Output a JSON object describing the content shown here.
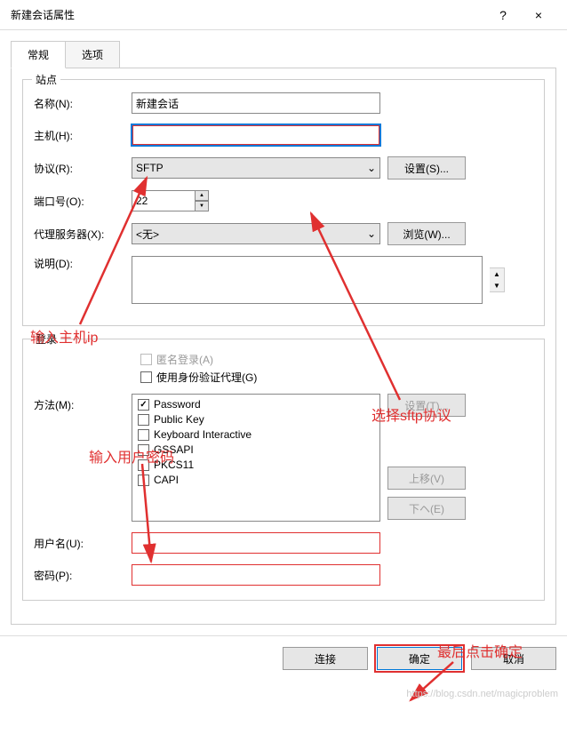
{
  "window": {
    "title": "新建会话属性",
    "help": "?",
    "close": "×"
  },
  "tabs": {
    "general": "常规",
    "options": "选项"
  },
  "site": {
    "legend": "站点",
    "name_label": "名称(N):",
    "name_value": "新建会话",
    "host_label": "主机(H):",
    "host_value": "",
    "protocol_label": "协议(R):",
    "protocol_value": "SFTP",
    "setup_btn": "设置(S)...",
    "port_label": "端口号(O):",
    "port_value": "22",
    "proxy_label": "代理服务器(X):",
    "proxy_value": "<无>",
    "browse_btn": "浏览(W)...",
    "desc_label": "说明(D):",
    "desc_value": ""
  },
  "login": {
    "legend": "登录",
    "anon_label": "匿名登录(A)",
    "auth_agent_label": "使用身份验证代理(G)",
    "method_label": "方法(M):",
    "methods": {
      "password": "Password",
      "publickey": "Public Key",
      "keyboard": "Keyboard Interactive",
      "gssapi": "GSSAPI",
      "pkcs11": "PKCS11",
      "capi": "CAPI"
    },
    "setup_btn": "设置(T)...",
    "moveup_btn": "上移(V)",
    "movedown_btn": "下ヘ(E)",
    "user_label": "用户名(U):",
    "user_value": "",
    "pass_label": "密码(P):",
    "pass_value": ""
  },
  "buttons": {
    "connect": "连接",
    "ok": "确定",
    "cancel": "取消"
  },
  "annotations": {
    "host": "输入主机ip",
    "protocol": "选择sftp协议",
    "userpass": "输入用户密码",
    "ok": "最后点击确定"
  },
  "watermark": "https://blog.csdn.net/magicproblem"
}
